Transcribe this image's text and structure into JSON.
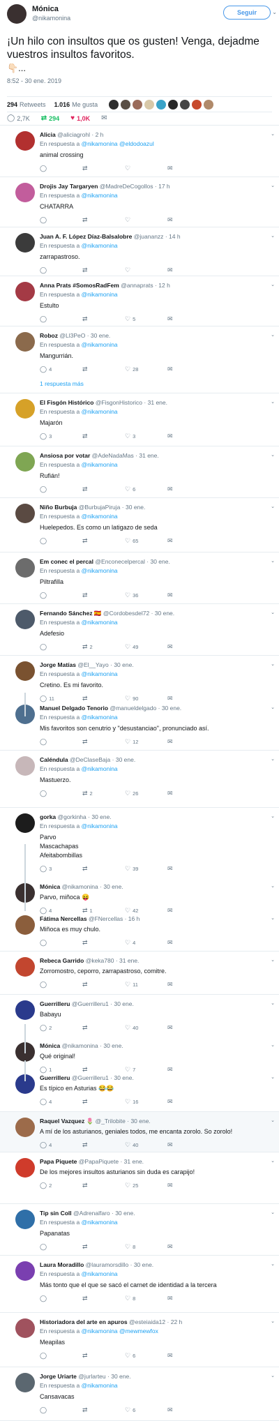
{
  "main_tweet": {
    "name": "Mónica",
    "handle": "@nikamonina",
    "follow_label": "Seguir",
    "chevron": "⌄",
    "text": "¡Un hilo con insultos que os gusten! Venga, dejadme vuestros insultos favoritos.",
    "emoji": "👇🏻...",
    "timestamp": "8:52 - 30 ene. 2019",
    "retweets_count": "294",
    "retweets_label": "Retweets",
    "likes_count": "1.016",
    "likes_label": "Me gusta",
    "actions": {
      "replies": "2,7K",
      "retweets": "294",
      "likes": "1,0K"
    }
  },
  "replies": [
    {
      "name": "Alicia",
      "handle": "@aliciagrohl",
      "time": "2 h",
      "reply_to_prefix": "En respuesta a",
      "reply_to": "@nikamonina @eldodoazul",
      "text": "animal crossing",
      "counts": [
        "",
        "",
        ""
      ],
      "avatar_color": "#b2302f"
    },
    {
      "name": "Drojis Jay Targaryen",
      "handle": "@MadreDeCogollos",
      "time": "17 h",
      "reply_to_prefix": "En respuesta a",
      "reply_to": "@nikamonina",
      "text": "CHATARRA",
      "counts": [
        "",
        "",
        ""
      ],
      "avatar_color": "#c25d9c"
    },
    {
      "name": "Juan A. F. López Díaz-Balsalobre",
      "handle": "@juananzz",
      "time": "14 h",
      "reply_to_prefix": "En respuesta a",
      "reply_to": "@nikamonina",
      "text": "zarrapastroso.",
      "counts": [
        "",
        "",
        ""
      ],
      "avatar_color": "#3b3b3b"
    },
    {
      "name": "Anna Prats #SomosRadFem",
      "handle": "@annaprats",
      "time": "12 h",
      "reply_to_prefix": "En respuesta a",
      "reply_to": "@nikamonina",
      "text": "Estulto",
      "counts": [
        "",
        "",
        "5"
      ],
      "avatar_color": "#a43a45"
    },
    {
      "name": "Roboz",
      "handle": "@Ll3PeO",
      "time": "30 ene.",
      "reply_to_prefix": "En respuesta a",
      "reply_to": "@nikamonina",
      "text": "Mangurrián.",
      "counts": [
        "4",
        "",
        "28"
      ],
      "more": "1 respuesta más",
      "avatar_color": "#8b6a4c"
    },
    {
      "name": "El Fisgón Histórico",
      "handle": "@FisgonHistorico",
      "time": "31 ene.",
      "reply_to_prefix": "En respuesta a",
      "reply_to": "@nikamonina",
      "text": "Majarón",
      "counts": [
        "3",
        "",
        "3"
      ],
      "avatar_color": "#d6a128"
    },
    {
      "name": "Ansiosa por votar",
      "handle": "@AdeNadaMas",
      "time": "31 ene.",
      "reply_to_prefix": "En respuesta a",
      "reply_to": "@nikamonina",
      "text": "Rufián!",
      "counts": [
        "",
        "",
        "6"
      ],
      "avatar_color": "#7fa653"
    },
    {
      "name": "Niño Burbuja",
      "handle": "@BurbujaPiruja",
      "time": "30 ene.",
      "reply_to_prefix": "En respuesta a",
      "reply_to": "@nikamonina",
      "text": "Huelepedos. Es como un latigazo de seda",
      "counts": [
        "",
        "",
        "65"
      ],
      "avatar_color": "#5a4a42"
    },
    {
      "name": "Em conec el percal",
      "handle": "@Enconecelpercal",
      "time": "30 ene.",
      "reply_to_prefix": "En respuesta a",
      "reply_to": "@nikamonina",
      "text": "Piltrafilla",
      "counts": [
        "",
        "",
        "36"
      ],
      "avatar_color": "#6c6c6c"
    },
    {
      "name": "Fernando Sánchez 🇪🇸",
      "handle": "@Cordobesdel72",
      "time": "30 ene.",
      "reply_to_prefix": "En respuesta a",
      "reply_to": "@nikamonina",
      "text": "Adefesio",
      "counts": [
        "",
        "2",
        "49"
      ],
      "avatar_color": "#4d5a6a"
    },
    {
      "name": "Jorge Matías",
      "handle": "@El__Yayo",
      "time": "30 ene.",
      "reply_to_prefix": "En respuesta a",
      "reply_to": "@nikamonina",
      "text": "Cretino. Es mi favorito.",
      "counts": [
        "11",
        "",
        "90"
      ],
      "avatar_color": "#7a5230"
    },
    {
      "name": "Manuel Delgado Tenorio",
      "handle": "@manueldelgado",
      "time": "30 ene.",
      "reply_to_prefix": "En respuesta a",
      "reply_to": "@nikamonina",
      "text": "Mis favoritos son cenutrio y \"desustanciao\", pronunciado así.",
      "counts": [
        "",
        "",
        "12"
      ],
      "avatar_color": "#4e6f8f"
    },
    {
      "name": "Caléndula",
      "handle": "@DeClaseBaja",
      "time": "30 ene.",
      "reply_to_prefix": "En respuesta a",
      "reply_to": "@nikamonina",
      "text": "Mastuerzo.",
      "counts": [
        "",
        "2",
        "26"
      ],
      "avatar_color": "#c7b7b9"
    },
    {
      "name": "gorka",
      "handle": "@gorkinha",
      "time": "30 ene.",
      "reply_to_prefix": "En respuesta a",
      "reply_to": "@nikamonina",
      "text": "Parvo\nMascachapas\nAfeitabombillas",
      "counts": [
        "3",
        "",
        "39"
      ],
      "avatar_color": "#1c1c1c"
    },
    {
      "name": "Mónica",
      "handle": "@nikamonina",
      "time": "30 ene.",
      "reply_to_prefix": "",
      "reply_to": "",
      "text": "Parvo, miñoca 😝",
      "counts": [
        "4",
        "1",
        "42"
      ],
      "avatar_color": "#3a3030"
    },
    {
      "name": "Fátima Nercellas",
      "handle": "@FNercellas",
      "time": "16 h",
      "reply_to_prefix": "",
      "reply_to": "",
      "text": "Miñoca es muy chulo.",
      "counts": [
        "",
        "",
        "4"
      ],
      "avatar_color": "#8b5e3c"
    },
    {
      "name": "Rebeca Garrido",
      "handle": "@keka780",
      "time": "31 ene.",
      "reply_to_prefix": "",
      "reply_to": "",
      "text": "Zorromostro, ceporro, zarrapastroso, comitre.",
      "counts": [
        "",
        "",
        "11"
      ],
      "avatar_color": "#c2462f"
    },
    {
      "name": "Guerrilleru",
      "handle": "@Guerrilleru1",
      "time": "30 ene.",
      "reply_to_prefix": "",
      "reply_to": "",
      "text": "Babayu",
      "counts": [
        "2",
        "",
        "40"
      ],
      "avatar_color": "#2a3a8c"
    },
    {
      "name": "Mónica",
      "handle": "@nikamonina",
      "time": "30 ene.",
      "reply_to_prefix": "",
      "reply_to": "",
      "text": "Qué original!",
      "counts": [
        "1",
        "",
        "7"
      ],
      "avatar_color": "#3a3030"
    },
    {
      "name": "Guerrilleru",
      "handle": "@Guerrilleru1",
      "time": "30 ene.",
      "reply_to_prefix": "",
      "reply_to": "",
      "text": "Es típico en Asturias 😂😂",
      "counts": [
        "4",
        "",
        "16"
      ],
      "avatar_color": "#2a3a8c"
    },
    {
      "name": "Raquel Vazquez 🌷",
      "handle": "@_Trilobite",
      "time": "30 ene.",
      "reply_to_prefix": "",
      "reply_to": "",
      "text": "A mí de los asturianos, geniales todos, me encanta zorolo. So zorolo!",
      "counts": [
        "4",
        "",
        "40"
      ],
      "avatar_color": "#9c6b4a"
    },
    {
      "name": "Papa Piquete",
      "handle": "@PapaPiquete",
      "time": "31 ene.",
      "reply_to_prefix": "",
      "reply_to": "",
      "text": "De los mejores insultos asturianos sin duda es carapijo!",
      "counts": [
        "2",
        "",
        "25"
      ],
      "avatar_color": "#cf3b2b"
    },
    {
      "name": "Tip sin Coll",
      "handle": "@Adrenalfaro",
      "time": "30 ene.",
      "reply_to_prefix": "En respuesta a",
      "reply_to": "@nikamonina",
      "text": "Papanatas",
      "counts": [
        "",
        "",
        "8"
      ],
      "avatar_color": "#2f6fa8"
    },
    {
      "name": "Laura Moradillo",
      "handle": "@lauramorsdillo",
      "time": "30 ene.",
      "reply_to_prefix": "En respuesta a",
      "reply_to": "@nikamonina",
      "text": "Más tonto que el que se sacó el carnet de identidad a la tercera",
      "counts": [
        "",
        "",
        "8"
      ],
      "avatar_color": "#7a3fb0"
    },
    {
      "name": "Historiadora del arte en apuros",
      "handle": "@esteiaida12",
      "time": "22 h",
      "reply_to_prefix": "En respuesta a",
      "reply_to": "@nikamonina @mewmewfox",
      "text": "Meapilas",
      "counts": [
        "",
        "",
        "6"
      ],
      "avatar_color": "#a0525e"
    },
    {
      "name": "Jorge Uriarte",
      "handle": "@jurlarteu",
      "time": "30 ene.",
      "reply_to_prefix": "En respuesta a",
      "reply_to": "@nikamonina",
      "text": "Cansavacas",
      "counts": [
        "",
        "",
        "6"
      ],
      "avatar_color": "#5b6770"
    }
  ],
  "colors": {
    "accent": "#1da1f2",
    "retweet": "#17bf63",
    "like": "#e0245e",
    "muted": "#657786",
    "border": "#e6ecf0"
  },
  "icons": {
    "reply": "reply-bubble-icon",
    "retweet": "retweet-arrows-icon",
    "like": "heart-icon",
    "dm": "envelope-icon"
  }
}
